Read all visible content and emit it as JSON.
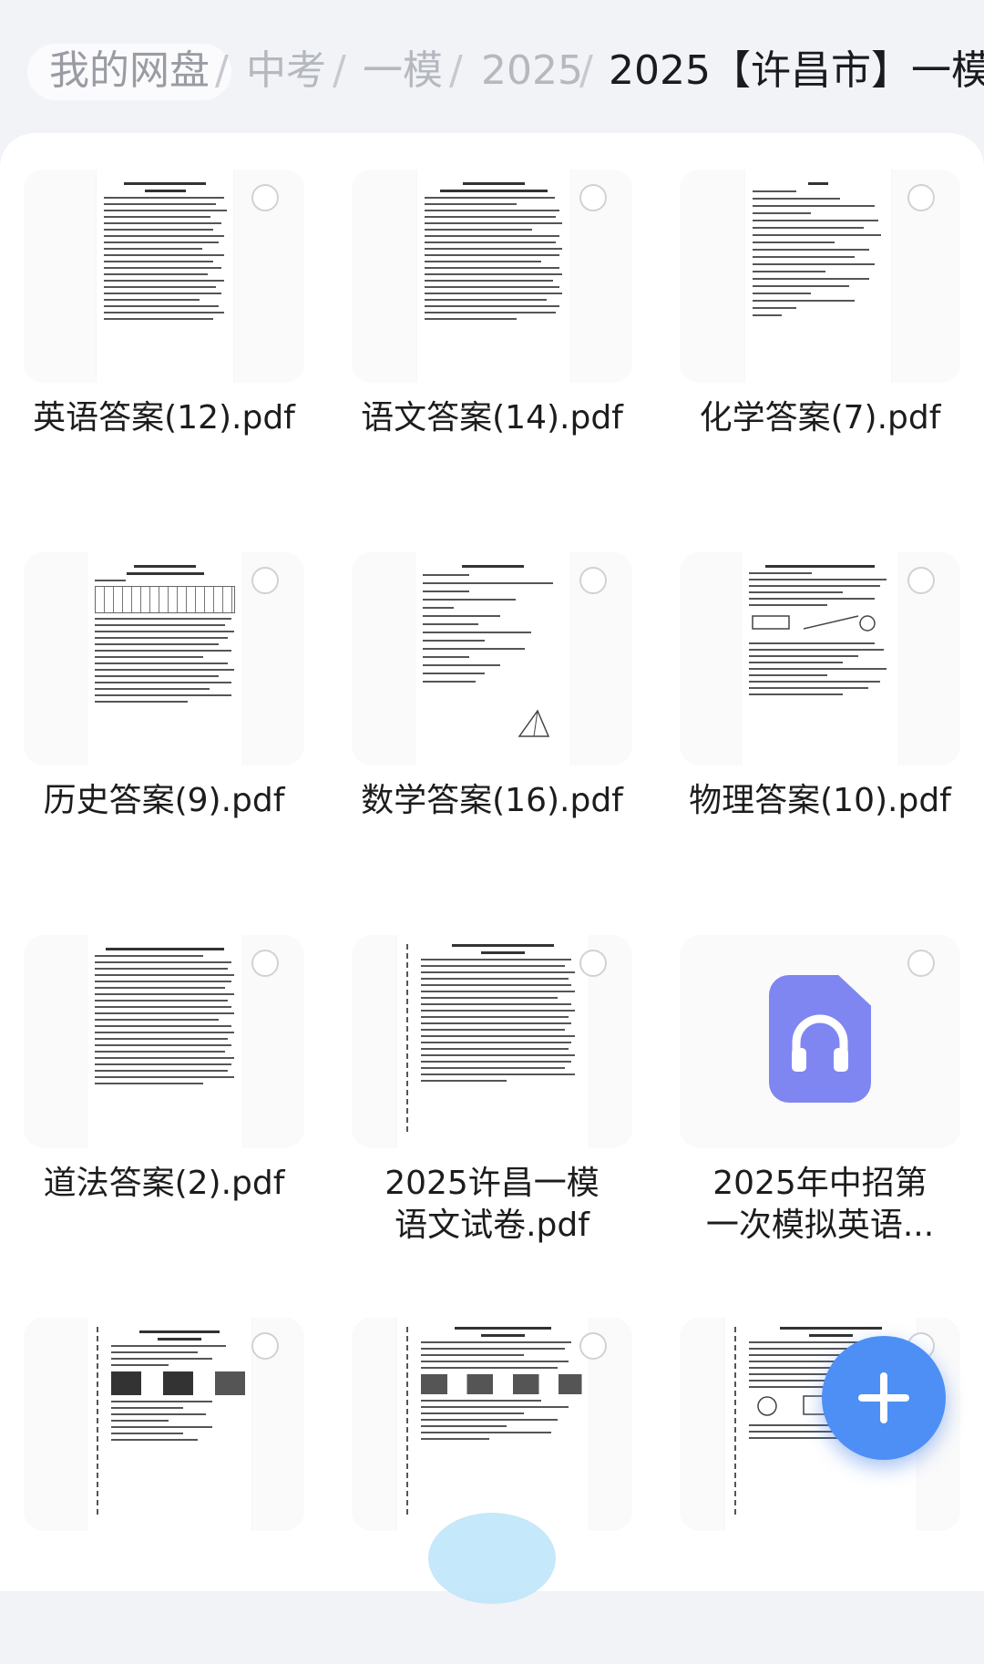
{
  "breadcrumb": {
    "home": "我的网盘",
    "level1": "中考",
    "level2": "一模",
    "level3": "2025",
    "current": "2025【许昌市】一模",
    "separator": "/"
  },
  "files": [
    {
      "name": "英语答案(12).pdf",
      "type": "pdf"
    },
    {
      "name": "语文答案(14).pdf",
      "type": "pdf"
    },
    {
      "name": "化学答案(7).pdf",
      "type": "pdf"
    },
    {
      "name": "历史答案(9).pdf",
      "type": "pdf"
    },
    {
      "name": "数学答案(16).pdf",
      "type": "pdf"
    },
    {
      "name": "物理答案(10).pdf",
      "type": "pdf"
    },
    {
      "name": "道法答案(2).pdf",
      "type": "pdf"
    },
    {
      "name_line1": "2025许昌一模",
      "name_line2": "语文试卷.pdf",
      "type": "pdf"
    },
    {
      "name_line1": "2025年中招第",
      "name_line2": "一次模拟英语...",
      "type": "audio"
    },
    {
      "type": "pdf"
    },
    {
      "type": "pdf"
    },
    {
      "type": "pdf"
    }
  ],
  "fab": {
    "icon": "plus-icon"
  },
  "colors": {
    "accent": "#4d8ff5",
    "audio_icon": "#7f86f2"
  }
}
